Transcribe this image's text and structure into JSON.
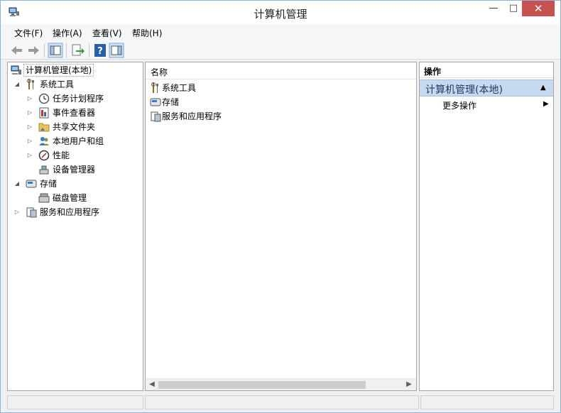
{
  "window": {
    "title": "计算机管理"
  },
  "controls": {
    "minimize": "—",
    "maximize": "□",
    "close": "✕"
  },
  "menu": [
    "文件(F)",
    "操作(A)",
    "查看(V)",
    "帮助(H)"
  ],
  "tree": {
    "root": "计算机管理(本地)",
    "system_tools": "系统工具",
    "task_scheduler": "任务计划程序",
    "event_viewer": "事件查看器",
    "shared_folders": "共享文件夹",
    "local_users": "本地用户和组",
    "performance": "性能",
    "device_manager": "设备管理器",
    "storage": "存储",
    "disk_management": "磁盘管理",
    "services_apps": "服务和应用程序"
  },
  "list": {
    "column_name": "名称",
    "rows": [
      "系统工具",
      "存储",
      "服务和应用程序"
    ]
  },
  "actions": {
    "header": "操作",
    "section": "计算机管理(本地)",
    "more": "更多操作"
  },
  "icons": [
    "back-arrow-icon",
    "forward-arrow-icon",
    "console-tree-icon",
    "export-list-icon",
    "help-icon",
    "action-pane-icon"
  ]
}
